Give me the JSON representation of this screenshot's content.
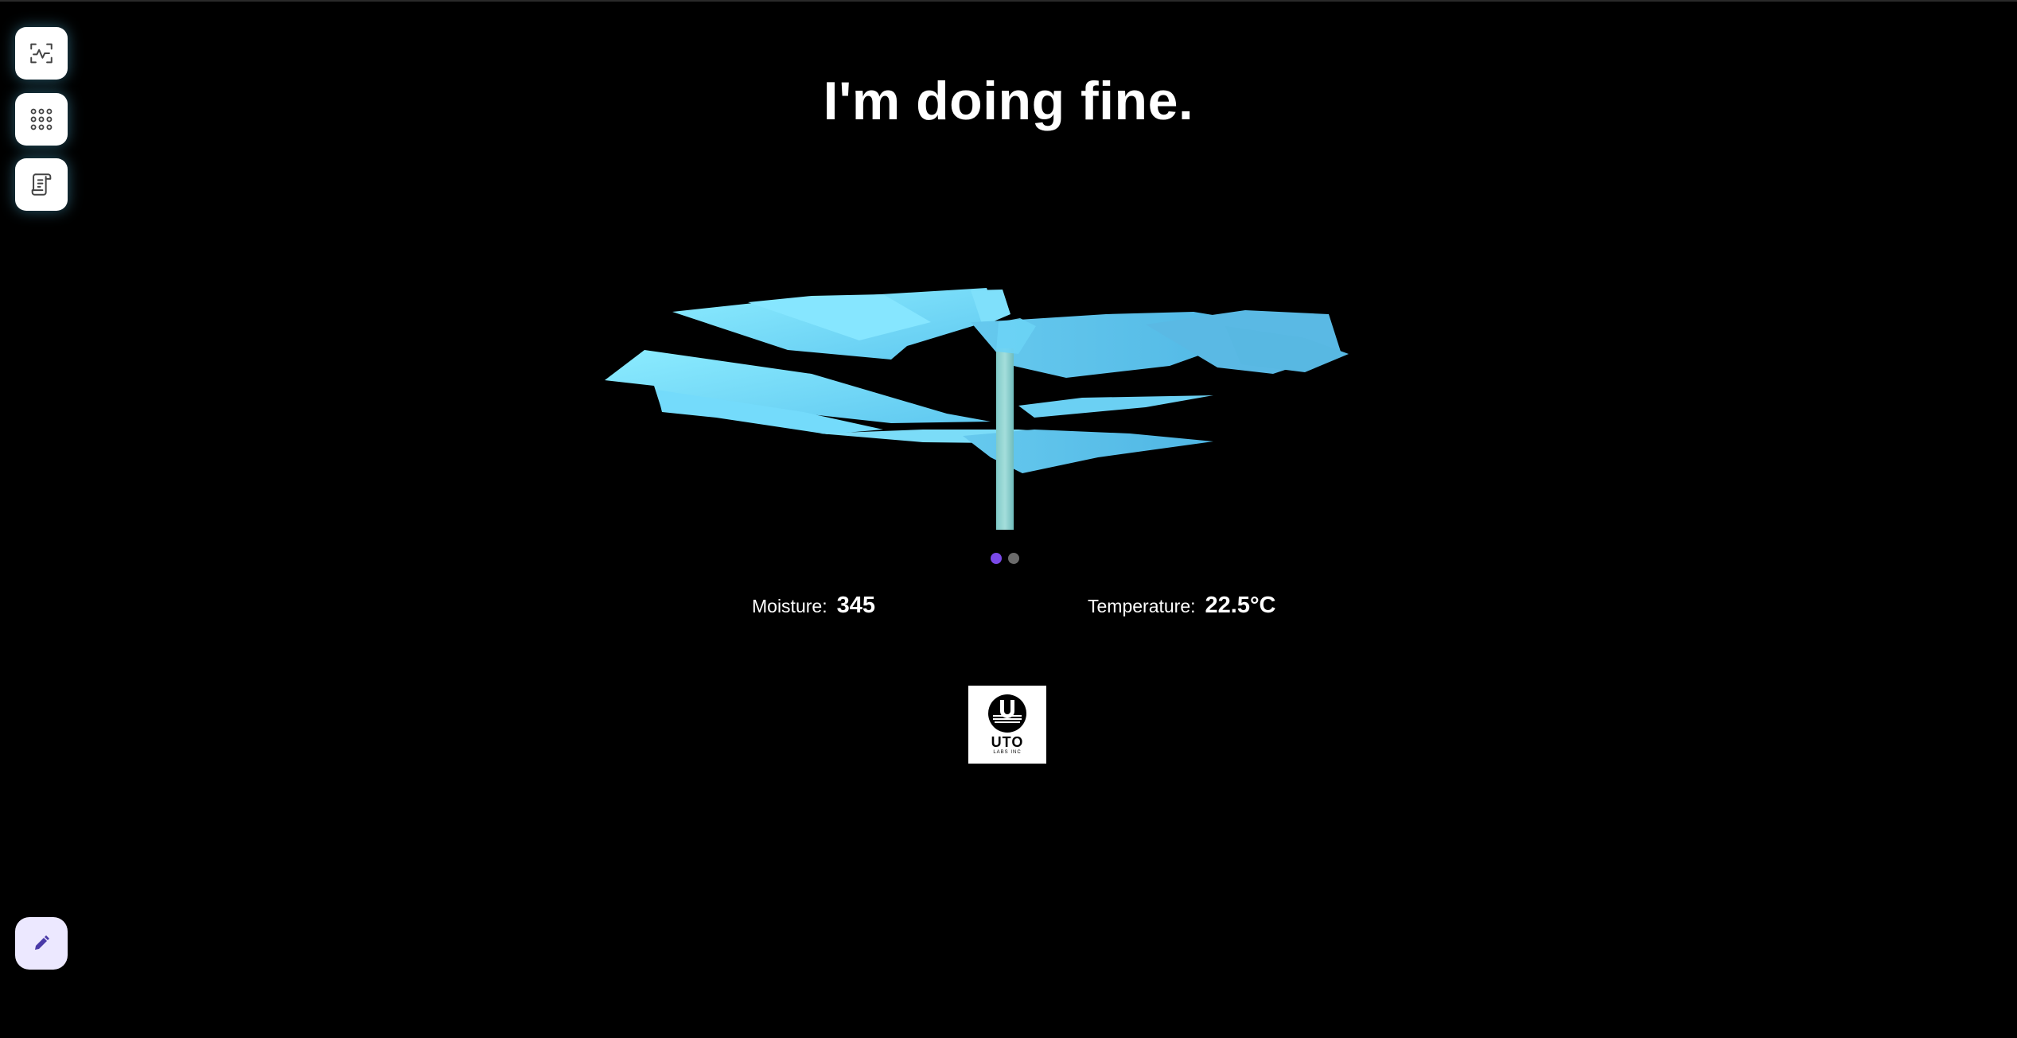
{
  "status": {
    "message": "I'm doing fine."
  },
  "nav": {
    "items": [
      {
        "icon": "scan-vitals-icon"
      },
      {
        "icon": "apps-grid-icon"
      },
      {
        "icon": "log-scroll-icon"
      }
    ],
    "edit_icon": "pencil-icon"
  },
  "carousel": {
    "count": 2,
    "active_index": 0,
    "active_color": "#7a49e8",
    "inactive_color": "#6b6b6b"
  },
  "readings": {
    "moisture_label": "Moisture:",
    "moisture_value": "345",
    "temperature_label": "Temperature:",
    "temperature_value": "22.5°C"
  },
  "logo": {
    "text": "UTO",
    "subtext": "LABS INC"
  },
  "colors": {
    "background": "#000000",
    "leaf": "#7fe3ff",
    "stem": "#8fd3cf"
  }
}
